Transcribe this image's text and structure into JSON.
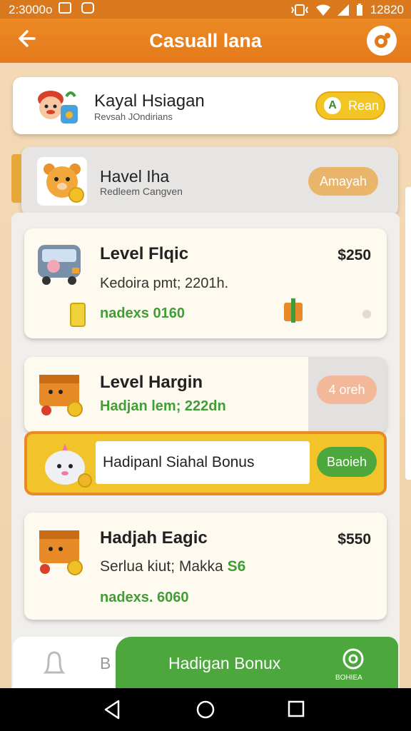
{
  "status_bar": {
    "time": "2:3000o",
    "clock": "12820"
  },
  "app_bar": {
    "title": "Casuall lana"
  },
  "top_card": {
    "title": "Kayal Hsiagan",
    "subtitle": "Revsah JOndirians",
    "button_icon": "A",
    "button_label": "Rean"
  },
  "second_card": {
    "title": "Havel Iha",
    "subtitle": "Redleem Cangven",
    "button_label": "Amayah"
  },
  "items": [
    {
      "title": "Level Flqic",
      "price": "$250",
      "desc": "Kedoira pmt; 2201h.",
      "reward": "nadexs 0160"
    },
    {
      "title": "Level Hargin",
      "price": "",
      "desc": "Hadjan lem; 222dn",
      "button_label": "4 oreh"
    },
    {
      "title": "Hadjah Eagic",
      "price": "$550",
      "desc": "Serlua kiut; Makka",
      "desc_highlight": "S6",
      "reward": "nadexs. 6060"
    }
  ],
  "bonus_banner": {
    "label": "Hadipanl Siahal Bonus",
    "button_label": "Baoieh"
  },
  "bottom_bar": {
    "left_letter": "B",
    "cta_label": "Hadigan Bonux",
    "right_label": "BOHIEA"
  },
  "colors": {
    "accent": "#e4791a",
    "green": "#4ca83c",
    "pill_orange": "#e9b56a",
    "pill_yellow": "#f2c524"
  }
}
